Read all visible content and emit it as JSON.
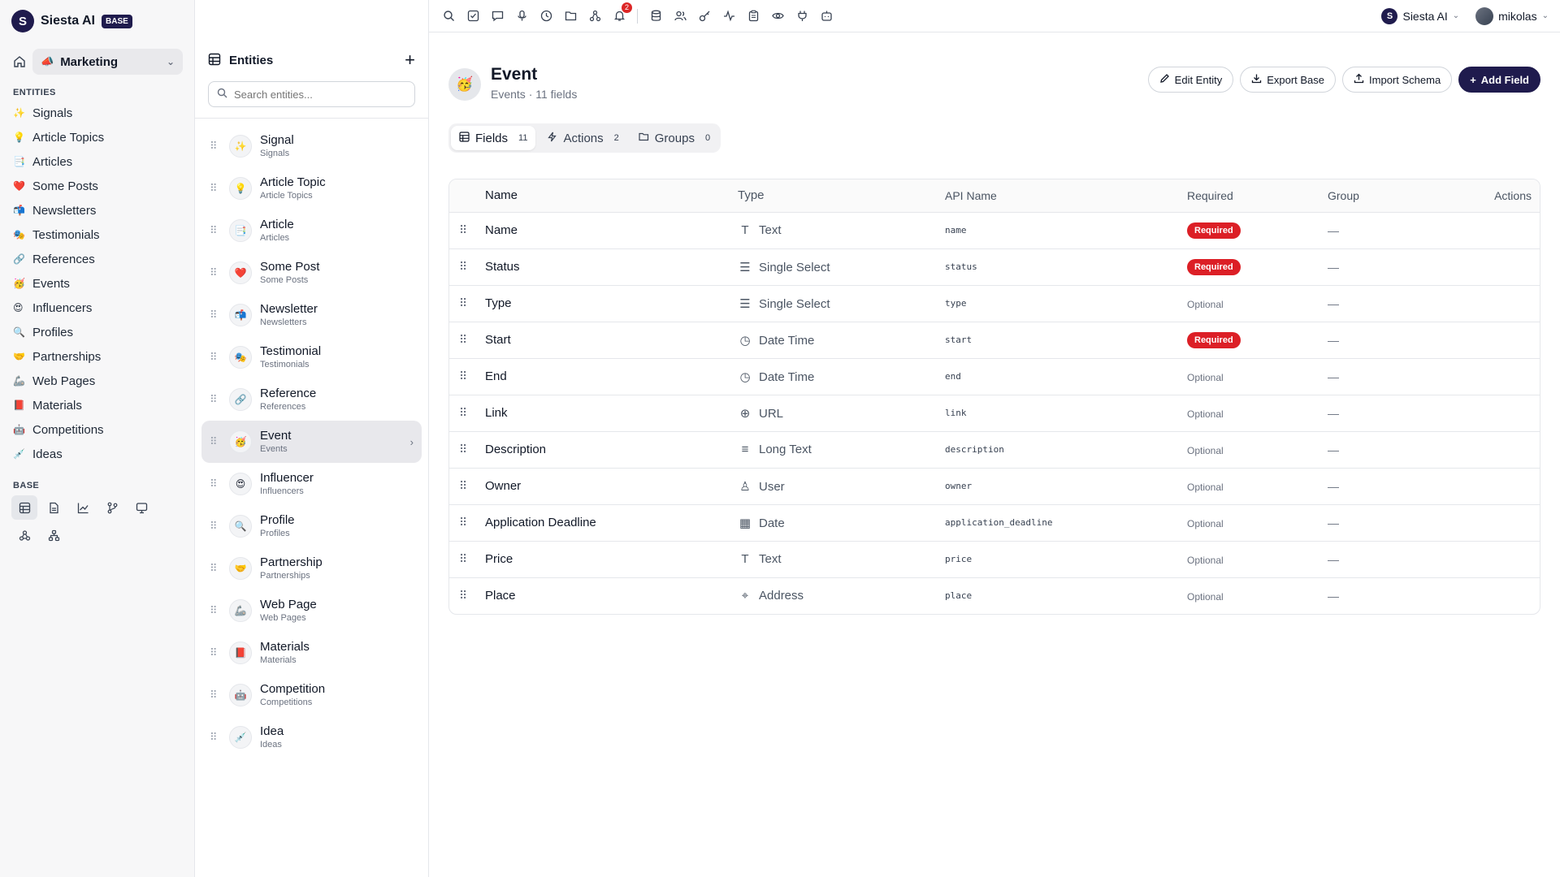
{
  "brand": {
    "name": "Siesta AI",
    "badge": "BASE"
  },
  "workspace": {
    "emoji": "📣",
    "name": "Marketing"
  },
  "sidebar": {
    "section_entities": "ENTITIES",
    "items": [
      {
        "emoji": "✨",
        "label": "Signals"
      },
      {
        "emoji": "💡",
        "label": "Article Topics"
      },
      {
        "emoji": "📑",
        "label": "Articles"
      },
      {
        "emoji": "❤️",
        "label": "Some Posts"
      },
      {
        "emoji": "📬",
        "label": "Newsletters"
      },
      {
        "emoji": "🎭",
        "label": "Testimonials"
      },
      {
        "emoji": "🔗",
        "label": "References"
      },
      {
        "emoji": "🥳",
        "label": "Events"
      },
      {
        "emoji": "😍",
        "label": "Influencers"
      },
      {
        "emoji": "🔍",
        "label": "Profiles"
      },
      {
        "emoji": "🤝",
        "label": "Partnerships"
      },
      {
        "emoji": "🦾",
        "label": "Web Pages"
      },
      {
        "emoji": "📕",
        "label": "Materials"
      },
      {
        "emoji": "🤖",
        "label": "Competitions"
      },
      {
        "emoji": "💉",
        "label": "Ideas"
      }
    ],
    "section_base": "BASE"
  },
  "entities_panel": {
    "title": "Entities",
    "search_placeholder": "Search entities...",
    "items": [
      {
        "emoji": "✨",
        "name": "Signal",
        "plural": "Signals"
      },
      {
        "emoji": "💡",
        "name": "Article Topic",
        "plural": "Article Topics"
      },
      {
        "emoji": "📑",
        "name": "Article",
        "plural": "Articles"
      },
      {
        "emoji": "❤️",
        "name": "Some Post",
        "plural": "Some Posts"
      },
      {
        "emoji": "📬",
        "name": "Newsletter",
        "plural": "Newsletters"
      },
      {
        "emoji": "🎭",
        "name": "Testimonial",
        "plural": "Testimonials"
      },
      {
        "emoji": "🔗",
        "name": "Reference",
        "plural": "References"
      },
      {
        "emoji": "🥳",
        "name": "Event",
        "plural": "Events",
        "active": true
      },
      {
        "emoji": "😍",
        "name": "Influencer",
        "plural": "Influencers"
      },
      {
        "emoji": "🔍",
        "name": "Profile",
        "plural": "Profiles"
      },
      {
        "emoji": "🤝",
        "name": "Partnership",
        "plural": "Partnerships"
      },
      {
        "emoji": "🦾",
        "name": "Web Page",
        "plural": "Web Pages"
      },
      {
        "emoji": "📕",
        "name": "Materials",
        "plural": "Materials"
      },
      {
        "emoji": "🤖",
        "name": "Competition",
        "plural": "Competitions"
      },
      {
        "emoji": "💉",
        "name": "Idea",
        "plural": "Ideas"
      }
    ]
  },
  "topbar": {
    "notification_count": "2",
    "org_name": "Siesta AI",
    "user_name": "mikolas"
  },
  "page": {
    "emoji": "🥳",
    "title": "Event",
    "subtitle": "Events · 11 fields",
    "buttons": {
      "edit": "Edit Entity",
      "export": "Export Base",
      "import": "Import Schema",
      "add": "Add Field"
    },
    "tabs": [
      {
        "label": "Fields",
        "count": "11"
      },
      {
        "label": "Actions",
        "count": "2"
      },
      {
        "label": "Groups",
        "count": "0"
      }
    ]
  },
  "table": {
    "headers": {
      "name": "Name",
      "type": "Type",
      "api": "API Name",
      "required": "Required",
      "group": "Group",
      "actions": "Actions"
    },
    "rows": [
      {
        "name": "Name",
        "type_icon": "T",
        "type": "Text",
        "api": "name",
        "required": "Required",
        "is_required": true,
        "group": "—"
      },
      {
        "name": "Status",
        "type_icon": "☰",
        "type": "Single Select",
        "api": "status",
        "required": "Required",
        "is_required": true,
        "group": "—"
      },
      {
        "name": "Type",
        "type_icon": "☰",
        "type": "Single Select",
        "api": "type",
        "required": "Optional",
        "is_required": false,
        "group": "—"
      },
      {
        "name": "Start",
        "type_icon": "◷",
        "type": "Date Time",
        "api": "start",
        "required": "Required",
        "is_required": true,
        "group": "—"
      },
      {
        "name": "End",
        "type_icon": "◷",
        "type": "Date Time",
        "api": "end",
        "required": "Optional",
        "is_required": false,
        "group": "—"
      },
      {
        "name": "Link",
        "type_icon": "⊕",
        "type": "URL",
        "api": "link",
        "required": "Optional",
        "is_required": false,
        "group": "—"
      },
      {
        "name": "Description",
        "type_icon": "≡",
        "type": "Long Text",
        "api": "description",
        "required": "Optional",
        "is_required": false,
        "group": "—"
      },
      {
        "name": "Owner",
        "type_icon": "♙",
        "type": "User",
        "api": "owner",
        "required": "Optional",
        "is_required": false,
        "group": "—"
      },
      {
        "name": "Application Deadline",
        "type_icon": "▦",
        "type": "Date",
        "api": "application_deadline",
        "required": "Optional",
        "is_required": false,
        "group": "—"
      },
      {
        "name": "Price",
        "type_icon": "T",
        "type": "Text",
        "api": "price",
        "required": "Optional",
        "is_required": false,
        "group": "—"
      },
      {
        "name": "Place",
        "type_icon": "⌖",
        "type": "Address",
        "api": "place",
        "required": "Optional",
        "is_required": false,
        "group": "—"
      }
    ]
  },
  "colors": {
    "brand": "#1f1b4d",
    "required": "#dc1f26"
  }
}
